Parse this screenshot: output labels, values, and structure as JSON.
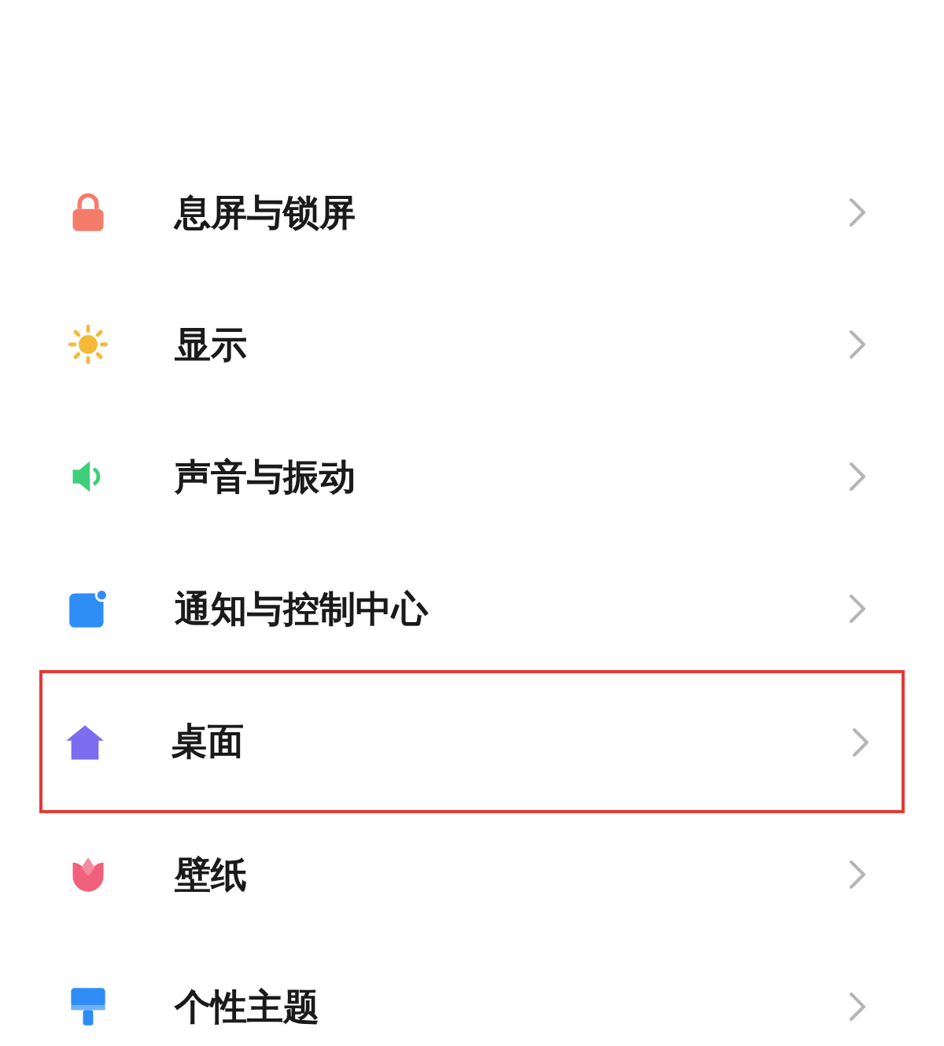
{
  "settings_items": [
    {
      "label": "息屏与锁屏",
      "kind": "lock",
      "highlighted": false
    },
    {
      "label": "显示",
      "kind": "sun",
      "highlighted": false
    },
    {
      "label": "声音与振动",
      "kind": "speaker",
      "highlighted": false
    },
    {
      "label": "通知与控制中心",
      "kind": "notification",
      "highlighted": false
    },
    {
      "label": "桌面",
      "kind": "home",
      "highlighted": true
    },
    {
      "label": "壁纸",
      "kind": "tulip",
      "highlighted": false
    },
    {
      "label": "个性主题",
      "kind": "brush",
      "highlighted": false
    }
  ]
}
